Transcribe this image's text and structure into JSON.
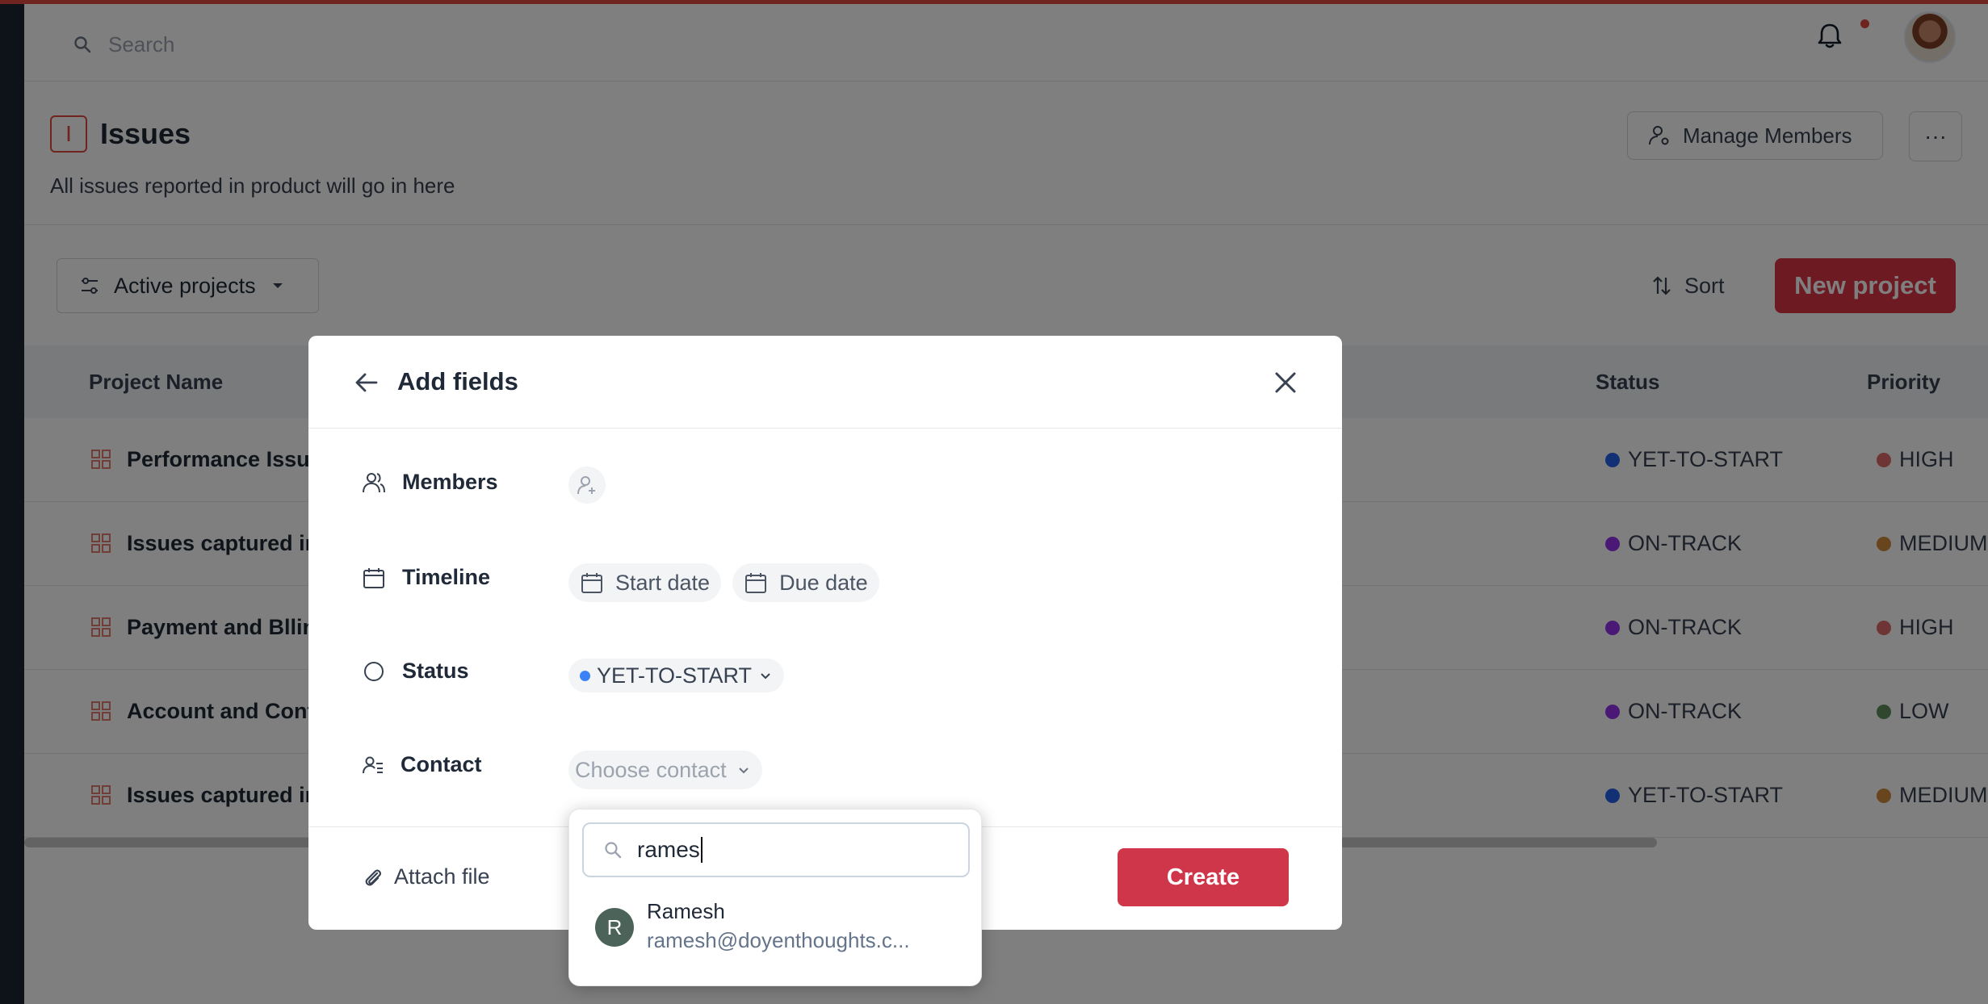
{
  "header": {
    "search_placeholder": "Search"
  },
  "page": {
    "title": "Issues",
    "badge_letter": "I",
    "description": "All issues reported in product will go in here",
    "manage_members_label": "Manage Members",
    "more_label": "···"
  },
  "toolbar": {
    "filter_label": "Active projects",
    "sort_label": "Sort",
    "new_project_label": "New project"
  },
  "table": {
    "columns": {
      "name": "Project Name",
      "status": "Status",
      "priority": "Priority"
    },
    "rows": [
      {
        "name": "Performance Issue",
        "status": "YET-TO-START",
        "status_color": "#2563eb",
        "priority": "HIGH",
        "priority_color": "#dc6b6b"
      },
      {
        "name": "Issues captured in",
        "status": "ON-TRACK",
        "status_color": "#9333ea",
        "priority": "MEDIUM",
        "priority_color": "#d08a3a"
      },
      {
        "name": "Payment and Bllin",
        "status": "ON-TRACK",
        "status_color": "#9333ea",
        "priority": "HIGH",
        "priority_color": "#dc6b6b"
      },
      {
        "name": "Account and Cont",
        "status": "ON-TRACK",
        "status_color": "#9333ea",
        "priority": "LOW",
        "priority_color": "#5f8f5f"
      },
      {
        "name": "Issues captured in",
        "status": "YET-TO-START",
        "status_color": "#2563eb",
        "priority": "MEDIUM",
        "priority_color": "#d08a3a"
      }
    ]
  },
  "modal": {
    "title": "Add fields",
    "fields": {
      "members_label": "Members",
      "timeline_label": "Timeline",
      "start_date": "Start date",
      "due_date": "Due date",
      "status_label": "Status",
      "status_value": "YET-TO-START",
      "status_color": "#3b82f6",
      "contact_label": "Contact",
      "contact_placeholder": "Choose contact"
    },
    "attach_label": "Attach file",
    "create_label": "Create"
  },
  "contact_dropdown": {
    "query": "rames",
    "results": [
      {
        "initial": "R",
        "name": "Ramesh",
        "email": "ramesh@doyenthoughts.c..."
      }
    ]
  },
  "colors": {
    "accent": "#dc3545",
    "sidebar": "#1c2733"
  }
}
